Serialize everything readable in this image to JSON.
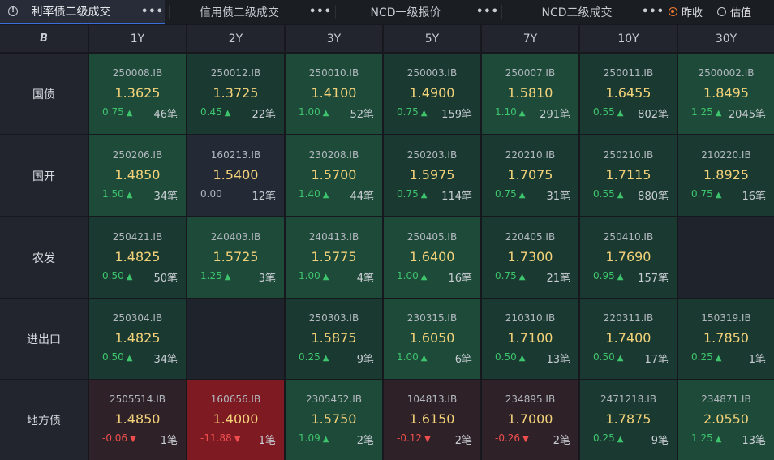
{
  "tabs": [
    {
      "label": "利率债二级成交",
      "active": true
    },
    {
      "label": "信用债二级成交",
      "active": false
    },
    {
      "label": "NCD一级报价",
      "active": false
    },
    {
      "label": "NCD二级成交",
      "active": false
    }
  ],
  "more_glyph": "•••",
  "info_glyph": "!",
  "radios": [
    {
      "label": "昨收",
      "checked": true
    },
    {
      "label": "估值",
      "checked": false
    }
  ],
  "corner_icon": "B",
  "columns": [
    "1Y",
    "2Y",
    "3Y",
    "5Y",
    "7Y",
    "10Y",
    "30Y"
  ],
  "rows": [
    {
      "label": "国债",
      "cells": [
        {
          "code": "250008.IB",
          "price": "1.3625",
          "chg": "0.75",
          "dir": "up",
          "count": "46笔",
          "bg": "#1e4a39"
        },
        {
          "code": "250012.IB",
          "price": "1.3725",
          "chg": "0.45",
          "dir": "up",
          "count": "22笔",
          "bg": "#1a3a31"
        },
        {
          "code": "250010.IB",
          "price": "1.4100",
          "chg": "1.00",
          "dir": "up",
          "count": "52笔",
          "bg": "#1e4a39"
        },
        {
          "code": "250003.IB",
          "price": "1.4900",
          "chg": "0.75",
          "dir": "up",
          "count": "159笔",
          "bg": "#1a3a31"
        },
        {
          "code": "250007.IB",
          "price": "1.5810",
          "chg": "1.10",
          "dir": "up",
          "count": "291笔",
          "bg": "#1e4a39"
        },
        {
          "code": "250011.IB",
          "price": "1.6455",
          "chg": "0.55",
          "dir": "up",
          "count": "802笔",
          "bg": "#1a3a31"
        },
        {
          "code": "2500002.IB",
          "price": "1.8495",
          "chg": "1.25",
          "dir": "up",
          "count": "2045笔",
          "bg": "#1e4a39"
        }
      ]
    },
    {
      "label": "国开",
      "cells": [
        {
          "code": "250206.IB",
          "price": "1.4850",
          "chg": "1.50",
          "dir": "up",
          "count": "34笔",
          "bg": "#1e4a39"
        },
        {
          "code": "160213.IB",
          "price": "1.5400",
          "chg": "0.00",
          "dir": "flat",
          "count": "12笔",
          "bg": "#232a36"
        },
        {
          "code": "230208.IB",
          "price": "1.5700",
          "chg": "1.40",
          "dir": "up",
          "count": "44笔",
          "bg": "#1e4a39"
        },
        {
          "code": "250203.IB",
          "price": "1.5975",
          "chg": "0.75",
          "dir": "up",
          "count": "114笔",
          "bg": "#1a3a31"
        },
        {
          "code": "220210.IB",
          "price": "1.7075",
          "chg": "0.75",
          "dir": "up",
          "count": "31笔",
          "bg": "#1a3a31"
        },
        {
          "code": "250210.IB",
          "price": "1.7115",
          "chg": "0.55",
          "dir": "up",
          "count": "880笔",
          "bg": "#1a3a31"
        },
        {
          "code": "210220.IB",
          "price": "1.8925",
          "chg": "0.75",
          "dir": "up",
          "count": "16笔",
          "bg": "#1a3a31"
        }
      ]
    },
    {
      "label": "农发",
      "cells": [
        {
          "code": "250421.IB",
          "price": "1.4825",
          "chg": "0.50",
          "dir": "up",
          "count": "50笔",
          "bg": "#1a3a31"
        },
        {
          "code": "240403.IB",
          "price": "1.5725",
          "chg": "1.25",
          "dir": "up",
          "count": "3笔",
          "bg": "#1e4a39"
        },
        {
          "code": "240413.IB",
          "price": "1.5775",
          "chg": "1.00",
          "dir": "up",
          "count": "4笔",
          "bg": "#1e4a39"
        },
        {
          "code": "250405.IB",
          "price": "1.6400",
          "chg": "1.00",
          "dir": "up",
          "count": "16笔",
          "bg": "#1e4a39"
        },
        {
          "code": "220405.IB",
          "price": "1.7300",
          "chg": "0.75",
          "dir": "up",
          "count": "21笔",
          "bg": "#1a3a31"
        },
        {
          "code": "250410.IB",
          "price": "1.7690",
          "chg": "0.95",
          "dir": "up",
          "count": "157笔",
          "bg": "#1a3a31"
        },
        null
      ]
    },
    {
      "label": "进出口",
      "cells": [
        {
          "code": "250304.IB",
          "price": "1.4825",
          "chg": "0.50",
          "dir": "up",
          "count": "34笔",
          "bg": "#1a3a31"
        },
        null,
        {
          "code": "250303.IB",
          "price": "1.5875",
          "chg": "0.25",
          "dir": "up",
          "count": "9笔",
          "bg": "#1a3a31"
        },
        {
          "code": "230315.IB",
          "price": "1.6050",
          "chg": "1.00",
          "dir": "up",
          "count": "6笔",
          "bg": "#1e4a39"
        },
        {
          "code": "210310.IB",
          "price": "1.7100",
          "chg": "0.50",
          "dir": "up",
          "count": "13笔",
          "bg": "#1a3a31"
        },
        {
          "code": "220311.IB",
          "price": "1.7400",
          "chg": "0.50",
          "dir": "up",
          "count": "17笔",
          "bg": "#1a3a31"
        },
        {
          "code": "150319.IB",
          "price": "1.7850",
          "chg": "0.25",
          "dir": "up",
          "count": "1笔",
          "bg": "#1a3a31"
        }
      ]
    },
    {
      "label": "地方债",
      "cells": [
        {
          "code": "2505514.IB",
          "price": "1.4850",
          "chg": "-0.06",
          "dir": "down",
          "count": "1笔",
          "bg": "#2e2228"
        },
        {
          "code": "160656.IB",
          "price": "1.4000",
          "chg": "-11.88",
          "dir": "down",
          "count": "1笔",
          "bg": "#7d1a22"
        },
        {
          "code": "2305452.IB",
          "price": "1.5750",
          "chg": "1.09",
          "dir": "up",
          "count": "2笔",
          "bg": "#1e4a39"
        },
        {
          "code": "104813.IB",
          "price": "1.6150",
          "chg": "-0.12",
          "dir": "down",
          "count": "2笔",
          "bg": "#2e2228"
        },
        {
          "code": "234895.IB",
          "price": "1.7000",
          "chg": "-0.26",
          "dir": "down",
          "count": "2笔",
          "bg": "#2e2228"
        },
        {
          "code": "2471218.IB",
          "price": "1.7875",
          "chg": "0.25",
          "dir": "up",
          "count": "9笔",
          "bg": "#1a3a31"
        },
        {
          "code": "234871.IB",
          "price": "2.0550",
          "chg": "1.25",
          "dir": "up",
          "count": "13笔",
          "bg": "#1e4a39"
        }
      ]
    }
  ],
  "colors": {
    "up": "#3ec46d",
    "down": "#f04e4e",
    "price": "#f4d27a",
    "empty_cell": "#1f232b",
    "accent": "#3a6fd8"
  }
}
